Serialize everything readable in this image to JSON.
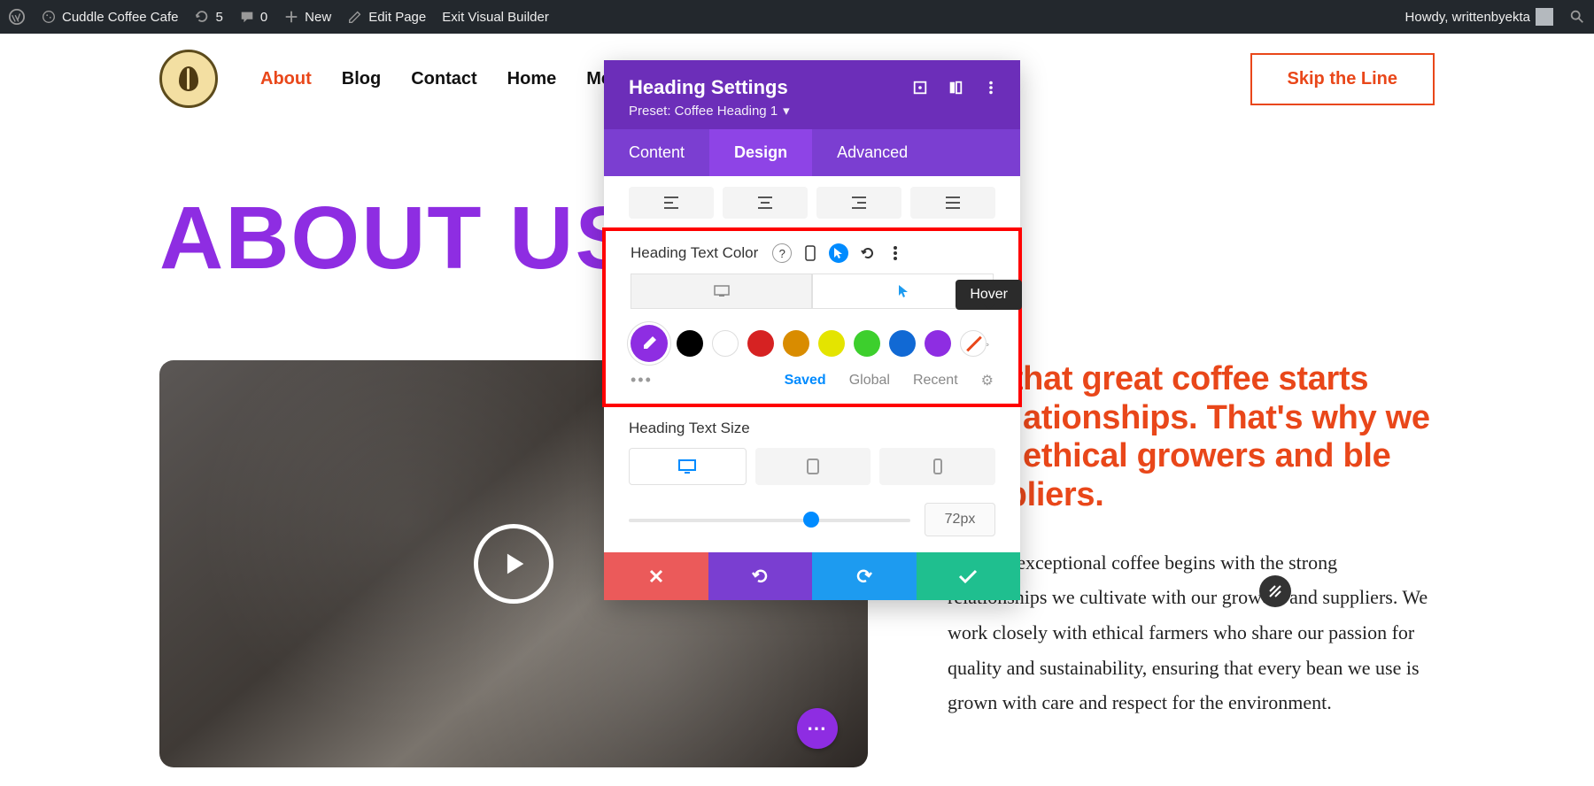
{
  "adminbar": {
    "site_name": "Cuddle Coffee Cafe",
    "refresh_count": "5",
    "comment_count": "0",
    "new_label": "New",
    "edit_label": "Edit Page",
    "exit_label": "Exit Visual Builder",
    "greeting": "Howdy, writtenbyekta"
  },
  "nav": {
    "about": "About",
    "blog": "Blog",
    "contact": "Contact",
    "home": "Home",
    "menu": "Menu"
  },
  "cta": "Skip the Line",
  "heading": "ABOUT US",
  "lead": "eve that great coffee starts with ationships. That's why we with ethical growers and ble suppliers.",
  "body": "tment to exceptional coffee begins with the strong relationships we cultivate with our growers and suppliers. We work closely with ethical farmers who share our passion for quality and sustainability, ensuring that every bean we use is grown with care and respect for the environment.",
  "panel": {
    "title": "Heading Settings",
    "preset": "Preset: Coffee Heading 1",
    "tabs": {
      "content": "Content",
      "design": "Design",
      "advanced": "Advanced"
    },
    "color_label": "Heading Text Color",
    "hover_tooltip": "Hover",
    "palette_tabs": {
      "saved": "Saved",
      "global": "Global",
      "recent": "Recent"
    },
    "size_label": "Heading Text Size",
    "size_value": "72px",
    "swatches": [
      "#000000",
      "#ffffff",
      "#d62222",
      "#d98c00",
      "#e4e400",
      "#3dcf2d",
      "#1169d4",
      "#8e2de2"
    ]
  }
}
